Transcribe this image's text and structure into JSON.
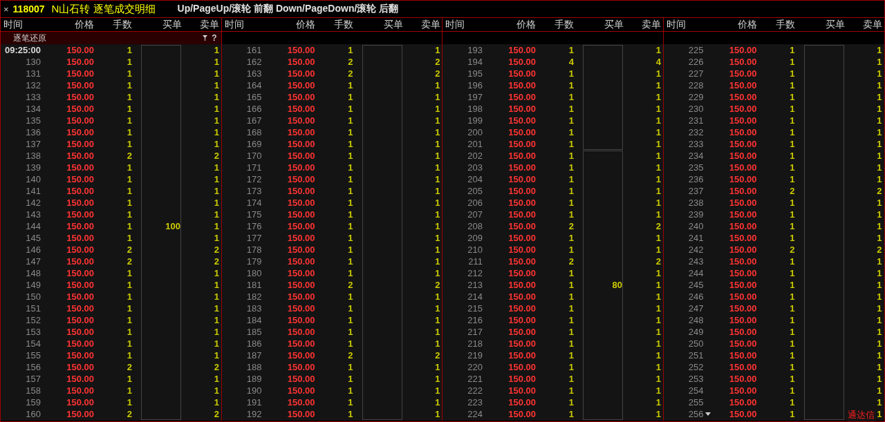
{
  "title_bar": {
    "close": "×",
    "code": "118007",
    "name": "N山石转 逐笔成交明细",
    "hint": "Up/PageUp/滚轮 前翻 Down/PageDown/滚轮 后翻"
  },
  "restore_bar": {
    "label": "逐笔还原",
    "help": "?"
  },
  "watermark_brand": "通达信",
  "panels": [
    {
      "columns": [
        "时间",
        "价格",
        "手数",
        "买单",
        "卖单"
      ],
      "rows": [
        {
          "time": "09:25:00",
          "price": "150.00",
          "lots": "1",
          "sell": "1",
          "box_start": true
        },
        {
          "time": "130",
          "price": "150.00",
          "lots": "1",
          "sell": "1",
          "box_start": false
        },
        {
          "time": "131",
          "price": "150.00",
          "lots": "1",
          "sell": "1",
          "box_start": false
        },
        {
          "time": "132",
          "price": "150.00",
          "lots": "1",
          "sell": "1",
          "box_start": false
        },
        {
          "time": "133",
          "price": "150.00",
          "lots": "1",
          "sell": "1",
          "box_start": false
        },
        {
          "time": "134",
          "price": "150.00",
          "lots": "1",
          "sell": "1",
          "box_start": false
        },
        {
          "time": "135",
          "price": "150.00",
          "lots": "1",
          "sell": "1",
          "box_start": false
        },
        {
          "time": "136",
          "price": "150.00",
          "lots": "1",
          "sell": "1",
          "box_start": false
        },
        {
          "time": "137",
          "price": "150.00",
          "lots": "1",
          "sell": "1",
          "box_start": false
        },
        {
          "time": "138",
          "price": "150.00",
          "lots": "2",
          "sell": "2",
          "box_start": false
        },
        {
          "time": "139",
          "price": "150.00",
          "lots": "1",
          "sell": "1",
          "box_start": false
        },
        {
          "time": "140",
          "price": "150.00",
          "lots": "1",
          "sell": "1",
          "box_start": false
        },
        {
          "time": "141",
          "price": "150.00",
          "lots": "1",
          "sell": "1",
          "box_start": false
        },
        {
          "time": "142",
          "price": "150.00",
          "lots": "1",
          "sell": "1",
          "box_start": false
        },
        {
          "time": "143",
          "price": "150.00",
          "lots": "1",
          "sell": "1",
          "box_start": false
        },
        {
          "time": "144",
          "price": "150.00",
          "lots": "1",
          "sell": "1",
          "box_start": false,
          "buy": "100"
        },
        {
          "time": "145",
          "price": "150.00",
          "lots": "1",
          "sell": "1",
          "box_start": false
        },
        {
          "time": "146",
          "price": "150.00",
          "lots": "2",
          "sell": "2",
          "box_start": false
        },
        {
          "time": "147",
          "price": "150.00",
          "lots": "2",
          "sell": "2",
          "box_start": false
        },
        {
          "time": "148",
          "price": "150.00",
          "lots": "1",
          "sell": "1",
          "box_start": false
        },
        {
          "time": "149",
          "price": "150.00",
          "lots": "1",
          "sell": "1",
          "box_start": false
        },
        {
          "time": "150",
          "price": "150.00",
          "lots": "1",
          "sell": "1",
          "box_start": false
        },
        {
          "time": "151",
          "price": "150.00",
          "lots": "1",
          "sell": "1",
          "box_start": false
        },
        {
          "time": "152",
          "price": "150.00",
          "lots": "1",
          "sell": "1",
          "box_start": false
        },
        {
          "time": "153",
          "price": "150.00",
          "lots": "1",
          "sell": "1",
          "box_start": false
        },
        {
          "time": "154",
          "price": "150.00",
          "lots": "1",
          "sell": "1",
          "box_start": false
        },
        {
          "time": "155",
          "price": "150.00",
          "lots": "1",
          "sell": "1",
          "box_start": false
        },
        {
          "time": "156",
          "price": "150.00",
          "lots": "2",
          "sell": "2",
          "box_start": false
        },
        {
          "time": "157",
          "price": "150.00",
          "lots": "1",
          "sell": "1",
          "box_start": false
        },
        {
          "time": "158",
          "price": "150.00",
          "lots": "1",
          "sell": "1",
          "box_start": false
        },
        {
          "time": "159",
          "price": "150.00",
          "lots": "1",
          "sell": "1",
          "box_start": false
        },
        {
          "time": "160",
          "price": "150.00",
          "lots": "2",
          "sell": "2",
          "box_start": false
        }
      ]
    },
    {
      "columns": [
        "时间",
        "价格",
        "手数",
        "买单",
        "卖单"
      ],
      "rows": [
        {
          "time": "161",
          "price": "150.00",
          "lots": "1",
          "sell": "1",
          "box_start": true
        },
        {
          "time": "162",
          "price": "150.00",
          "lots": "2",
          "sell": "2",
          "box_start": false
        },
        {
          "time": "163",
          "price": "150.00",
          "lots": "2",
          "sell": "2",
          "box_start": false
        },
        {
          "time": "164",
          "price": "150.00",
          "lots": "1",
          "sell": "1",
          "box_start": false
        },
        {
          "time": "165",
          "price": "150.00",
          "lots": "1",
          "sell": "1",
          "box_start": false
        },
        {
          "time": "166",
          "price": "150.00",
          "lots": "1",
          "sell": "1",
          "box_start": false
        },
        {
          "time": "167",
          "price": "150.00",
          "lots": "1",
          "sell": "1",
          "box_start": false
        },
        {
          "time": "168",
          "price": "150.00",
          "lots": "1",
          "sell": "1",
          "box_start": false
        },
        {
          "time": "169",
          "price": "150.00",
          "lots": "1",
          "sell": "1",
          "box_start": false
        },
        {
          "time": "170",
          "price": "150.00",
          "lots": "1",
          "sell": "1",
          "box_start": false
        },
        {
          "time": "171",
          "price": "150.00",
          "lots": "1",
          "sell": "1",
          "box_start": false
        },
        {
          "time": "172",
          "price": "150.00",
          "lots": "1",
          "sell": "1",
          "box_start": false
        },
        {
          "time": "173",
          "price": "150.00",
          "lots": "1",
          "sell": "1",
          "box_start": false
        },
        {
          "time": "174",
          "price": "150.00",
          "lots": "1",
          "sell": "1",
          "box_start": false
        },
        {
          "time": "175",
          "price": "150.00",
          "lots": "1",
          "sell": "1",
          "box_start": false
        },
        {
          "time": "176",
          "price": "150.00",
          "lots": "1",
          "sell": "1",
          "box_start": false
        },
        {
          "time": "177",
          "price": "150.00",
          "lots": "1",
          "sell": "1",
          "box_start": false
        },
        {
          "time": "178",
          "price": "150.00",
          "lots": "1",
          "sell": "1",
          "box_start": false
        },
        {
          "time": "179",
          "price": "150.00",
          "lots": "1",
          "sell": "1",
          "box_start": false
        },
        {
          "time": "180",
          "price": "150.00",
          "lots": "1",
          "sell": "1",
          "box_start": false
        },
        {
          "time": "181",
          "price": "150.00",
          "lots": "2",
          "sell": "2",
          "box_start": false
        },
        {
          "time": "182",
          "price": "150.00",
          "lots": "1",
          "sell": "1",
          "box_start": false
        },
        {
          "time": "183",
          "price": "150.00",
          "lots": "1",
          "sell": "1",
          "box_start": false
        },
        {
          "time": "184",
          "price": "150.00",
          "lots": "1",
          "sell": "1",
          "box_start": false
        },
        {
          "time": "185",
          "price": "150.00",
          "lots": "1",
          "sell": "1",
          "box_start": false
        },
        {
          "time": "186",
          "price": "150.00",
          "lots": "1",
          "sell": "1",
          "box_start": false
        },
        {
          "time": "187",
          "price": "150.00",
          "lots": "2",
          "sell": "2",
          "box_start": false
        },
        {
          "time": "188",
          "price": "150.00",
          "lots": "1",
          "sell": "1",
          "box_start": false
        },
        {
          "time": "189",
          "price": "150.00",
          "lots": "1",
          "sell": "1",
          "box_start": false
        },
        {
          "time": "190",
          "price": "150.00",
          "lots": "1",
          "sell": "1",
          "box_start": false
        },
        {
          "time": "191",
          "price": "150.00",
          "lots": "1",
          "sell": "1",
          "box_start": false
        },
        {
          "time": "192",
          "price": "150.00",
          "lots": "1",
          "sell": "1",
          "box_start": false
        }
      ]
    },
    {
      "columns": [
        "时间",
        "价格",
        "手数",
        "买单",
        "卖单"
      ],
      "rows": [
        {
          "time": "193",
          "price": "150.00",
          "lots": "1",
          "sell": "1",
          "box_start": true
        },
        {
          "time": "194",
          "price": "150.00",
          "lots": "4",
          "sell": "4",
          "box_start": false
        },
        {
          "time": "195",
          "price": "150.00",
          "lots": "1",
          "sell": "1",
          "box_start": false
        },
        {
          "time": "196",
          "price": "150.00",
          "lots": "1",
          "sell": "1",
          "box_start": false
        },
        {
          "time": "197",
          "price": "150.00",
          "lots": "1",
          "sell": "1",
          "box_start": false
        },
        {
          "time": "198",
          "price": "150.00",
          "lots": "1",
          "sell": "1",
          "box_start": false
        },
        {
          "time": "199",
          "price": "150.00",
          "lots": "1",
          "sell": "1",
          "box_start": false
        },
        {
          "time": "200",
          "price": "150.00",
          "lots": "1",
          "sell": "1",
          "box_start": false
        },
        {
          "time": "201",
          "price": "150.00",
          "lots": "1",
          "sell": "1",
          "box_start": false
        },
        {
          "time": "202",
          "price": "150.00",
          "lots": "1",
          "sell": "1",
          "box_start": true
        },
        {
          "time": "203",
          "price": "150.00",
          "lots": "1",
          "sell": "1",
          "box_start": false
        },
        {
          "time": "204",
          "price": "150.00",
          "lots": "1",
          "sell": "1",
          "box_start": false
        },
        {
          "time": "205",
          "price": "150.00",
          "lots": "1",
          "sell": "1",
          "box_start": false
        },
        {
          "time": "206",
          "price": "150.00",
          "lots": "1",
          "sell": "1",
          "box_start": false
        },
        {
          "time": "207",
          "price": "150.00",
          "lots": "1",
          "sell": "1",
          "box_start": false
        },
        {
          "time": "208",
          "price": "150.00",
          "lots": "2",
          "sell": "2",
          "box_start": false
        },
        {
          "time": "209",
          "price": "150.00",
          "lots": "1",
          "sell": "1",
          "box_start": false
        },
        {
          "time": "210",
          "price": "150.00",
          "lots": "1",
          "sell": "1",
          "box_start": false
        },
        {
          "time": "211",
          "price": "150.00",
          "lots": "2",
          "sell": "2",
          "box_start": false
        },
        {
          "time": "212",
          "price": "150.00",
          "lots": "1",
          "sell": "1",
          "box_start": false
        },
        {
          "time": "213",
          "price": "150.00",
          "lots": "1",
          "sell": "1",
          "box_start": false,
          "buy": "80"
        },
        {
          "time": "214",
          "price": "150.00",
          "lots": "1",
          "sell": "1",
          "box_start": false
        },
        {
          "time": "215",
          "price": "150.00",
          "lots": "1",
          "sell": "1",
          "box_start": false
        },
        {
          "time": "216",
          "price": "150.00",
          "lots": "1",
          "sell": "1",
          "box_start": false
        },
        {
          "time": "217",
          "price": "150.00",
          "lots": "1",
          "sell": "1",
          "box_start": false
        },
        {
          "time": "218",
          "price": "150.00",
          "lots": "1",
          "sell": "1",
          "box_start": false
        },
        {
          "time": "219",
          "price": "150.00",
          "lots": "1",
          "sell": "1",
          "box_start": false
        },
        {
          "time": "220",
          "price": "150.00",
          "lots": "1",
          "sell": "1",
          "box_start": false
        },
        {
          "time": "221",
          "price": "150.00",
          "lots": "1",
          "sell": "1",
          "box_start": false
        },
        {
          "time": "222",
          "price": "150.00",
          "lots": "1",
          "sell": "1",
          "box_start": false
        },
        {
          "time": "223",
          "price": "150.00",
          "lots": "1",
          "sell": "1",
          "box_start": false
        },
        {
          "time": "224",
          "price": "150.00",
          "lots": "1",
          "sell": "1",
          "box_start": false
        }
      ]
    },
    {
      "columns": [
        "时间",
        "价格",
        "手数",
        "买单",
        "卖单"
      ],
      "rows": [
        {
          "time": "225",
          "price": "150.00",
          "lots": "1",
          "sell": "1",
          "box_start": true
        },
        {
          "time": "226",
          "price": "150.00",
          "lots": "1",
          "sell": "1",
          "box_start": false
        },
        {
          "time": "227",
          "price": "150.00",
          "lots": "1",
          "sell": "1",
          "box_start": false
        },
        {
          "time": "228",
          "price": "150.00",
          "lots": "1",
          "sell": "1",
          "box_start": false
        },
        {
          "time": "229",
          "price": "150.00",
          "lots": "1",
          "sell": "1",
          "box_start": false
        },
        {
          "time": "230",
          "price": "150.00",
          "lots": "1",
          "sell": "1",
          "box_start": false
        },
        {
          "time": "231",
          "price": "150.00",
          "lots": "1",
          "sell": "1",
          "box_start": false
        },
        {
          "time": "232",
          "price": "150.00",
          "lots": "1",
          "sell": "1",
          "box_start": false
        },
        {
          "time": "233",
          "price": "150.00",
          "lots": "1",
          "sell": "1",
          "box_start": false
        },
        {
          "time": "234",
          "price": "150.00",
          "lots": "1",
          "sell": "1",
          "box_start": false
        },
        {
          "time": "235",
          "price": "150.00",
          "lots": "1",
          "sell": "1",
          "box_start": false
        },
        {
          "time": "236",
          "price": "150.00",
          "lots": "1",
          "sell": "1",
          "box_start": false
        },
        {
          "time": "237",
          "price": "150.00",
          "lots": "2",
          "sell": "2",
          "box_start": false
        },
        {
          "time": "238",
          "price": "150.00",
          "lots": "1",
          "sell": "1",
          "box_start": false
        },
        {
          "time": "239",
          "price": "150.00",
          "lots": "1",
          "sell": "1",
          "box_start": false
        },
        {
          "time": "240",
          "price": "150.00",
          "lots": "1",
          "sell": "1",
          "box_start": false
        },
        {
          "time": "241",
          "price": "150.00",
          "lots": "1",
          "sell": "1",
          "box_start": false
        },
        {
          "time": "242",
          "price": "150.00",
          "lots": "2",
          "sell": "2",
          "box_start": false
        },
        {
          "time": "243",
          "price": "150.00",
          "lots": "1",
          "sell": "1",
          "box_start": false
        },
        {
          "time": "244",
          "price": "150.00",
          "lots": "1",
          "sell": "1",
          "box_start": false
        },
        {
          "time": "245",
          "price": "150.00",
          "lots": "1",
          "sell": "1",
          "box_start": false
        },
        {
          "time": "246",
          "price": "150.00",
          "lots": "1",
          "sell": "1",
          "box_start": false
        },
        {
          "time": "247",
          "price": "150.00",
          "lots": "1",
          "sell": "1",
          "box_start": false
        },
        {
          "time": "248",
          "price": "150.00",
          "lots": "1",
          "sell": "1",
          "box_start": false
        },
        {
          "time": "249",
          "price": "150.00",
          "lots": "1",
          "sell": "1",
          "box_start": false
        },
        {
          "time": "250",
          "price": "150.00",
          "lots": "1",
          "sell": "1",
          "box_start": false
        },
        {
          "time": "251",
          "price": "150.00",
          "lots": "1",
          "sell": "1",
          "box_start": false
        },
        {
          "time": "252",
          "price": "150.00",
          "lots": "1",
          "sell": "1",
          "box_start": false
        },
        {
          "time": "253",
          "price": "150.00",
          "lots": "1",
          "sell": "1",
          "box_start": false
        },
        {
          "time": "254",
          "price": "150.00",
          "lots": "1",
          "sell": "1",
          "box_start": false
        },
        {
          "time": "255",
          "price": "150.00",
          "lots": "1",
          "sell": "1",
          "box_start": false
        },
        {
          "time": "256",
          "price": "150.00",
          "lots": "1",
          "sell": "1",
          "box_start": false
        }
      ]
    }
  ]
}
